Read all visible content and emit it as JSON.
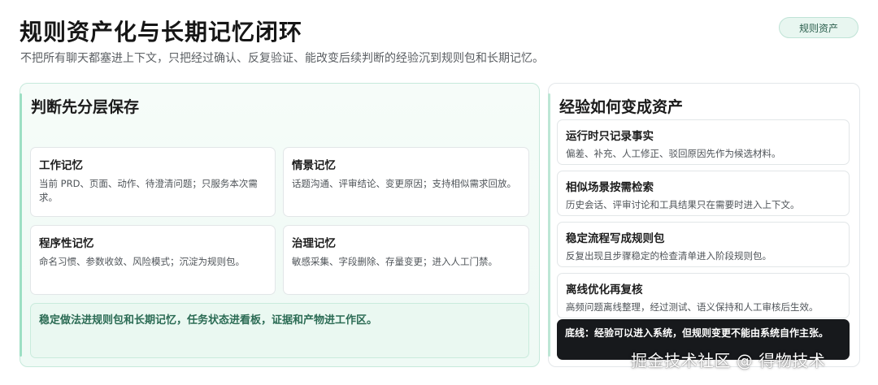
{
  "header": {
    "title": "规则资产化与长期记忆闭环",
    "subtitle": "不把所有聊天都塞进上下文，只把经过确认、反复验证、能改变后续判断的经验沉到规则包和长期记忆。",
    "tag": "规则资产"
  },
  "left_panel": {
    "title": "判断先分层保存",
    "cards": [
      {
        "title": "工作记忆",
        "text": "当前 PRD、页面、动作、待澄清问题；只服务本次需求。"
      },
      {
        "title": "情景记忆",
        "text": "话题沟通、评审结论、变更原因；支持相似需求回放。"
      },
      {
        "title": "程序性记忆",
        "text": "命名习惯、参数收敛、风险模式；沉淀为规则包。"
      },
      {
        "title": "治理记忆",
        "text": "敏感采集、字段删除、存量变更；进入人工门禁。"
      }
    ],
    "note": "稳定做法进规则包和长期记忆，任务状态进看板，证据和产物进工作区。"
  },
  "right_panel": {
    "title": "经验如何变成资产",
    "steps": [
      {
        "title": "运行时只记录事实",
        "text": "偏差、补充、人工修正、驳回原因先作为候选材料。"
      },
      {
        "title": "相似场景按需检索",
        "text": "历史会话、评审讨论和工具结果只在需要时进入上下文。"
      },
      {
        "title": "稳定流程写成规则包",
        "text": "反复出现且步骤稳定的检查清单进入阶段规则包。"
      },
      {
        "title": "离线优化再复核",
        "text": "高频问题离线整理，经过测试、语义保持和人工审核后生效。"
      }
    ],
    "bottom_line": "底线：经验可以进入系统，但规则变更不能由系统自作主张。"
  },
  "watermark": "掘金技术社区 @ 得物技术",
  "colors": {
    "accent_green": "#9ddfc4",
    "note_green_bg": "#eaf8f1",
    "note_green_text": "#2b6b54",
    "dark_note_bg": "#17191c"
  }
}
